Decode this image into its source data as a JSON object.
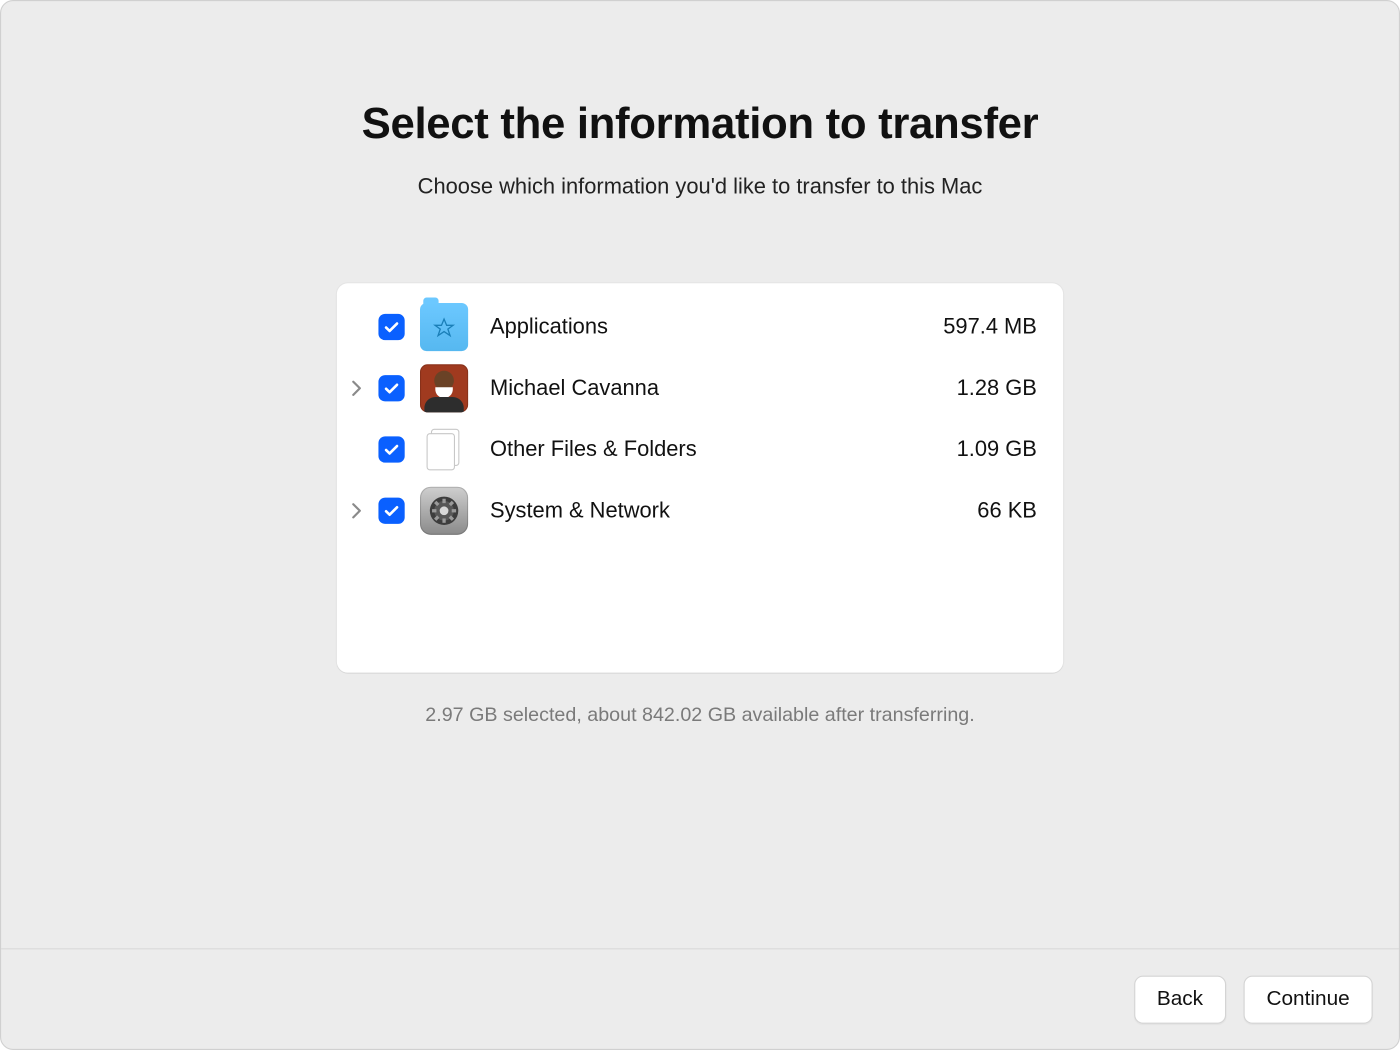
{
  "title": "Select the information to transfer",
  "subtitle": "Choose which information you'd like to transfer to this Mac",
  "items": [
    {
      "label": "Applications",
      "size": "597.4 MB",
      "icon": "applications-folder-icon",
      "expandable": false,
      "checked": true
    },
    {
      "label": "Michael Cavanna",
      "size": "1.28 GB",
      "icon": "user-avatar-icon",
      "expandable": true,
      "checked": true
    },
    {
      "label": "Other Files & Folders",
      "size": "1.09 GB",
      "icon": "documents-icon",
      "expandable": false,
      "checked": true
    },
    {
      "label": "System & Network",
      "size": "66 KB",
      "icon": "system-settings-icon",
      "expandable": true,
      "checked": true
    }
  ],
  "summary": "2.97 GB selected, about 842.02 GB available after transferring.",
  "buttons": {
    "back": "Back",
    "continue": "Continue"
  }
}
